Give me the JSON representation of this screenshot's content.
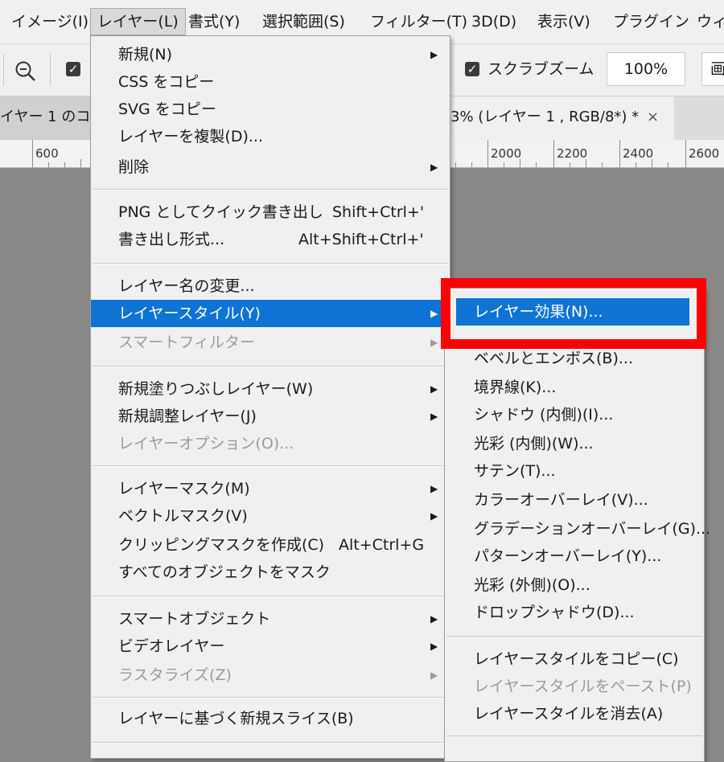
{
  "menubar": {
    "items": [
      {
        "label": "イメージ(I)"
      },
      {
        "label": "レイヤー(L)"
      },
      {
        "label": "書式(Y)"
      },
      {
        "label": "選択範囲(S)"
      },
      {
        "label": "フィルター(T)"
      },
      {
        "label": "3D(D)"
      },
      {
        "label": "表示(V)"
      },
      {
        "label": "プラグイン"
      },
      {
        "label": "ウィ"
      }
    ]
  },
  "options": {
    "scrubby_zoom_label": "スクラブズーム",
    "zoom_value": "100%",
    "fill_screen_label": "画"
  },
  "tabs": [
    {
      "label": "イヤー 1 のコ"
    },
    {
      "label": "3% (レイヤー 1 , RGB/8*) *"
    }
  ],
  "ruler": {
    "labels": [
      "600",
      "2000",
      "2200",
      "2400",
      "2600"
    ]
  },
  "layer_menu": {
    "items": [
      {
        "label": "新規(N)",
        "shortcut": "",
        "submenu": true,
        "disabled": false
      },
      {
        "label": "CSS をコピー",
        "shortcut": "",
        "submenu": false,
        "disabled": false
      },
      {
        "label": "SVG をコピー",
        "shortcut": "",
        "submenu": false,
        "disabled": false
      },
      {
        "label": "レイヤーを複製(D)...",
        "shortcut": "",
        "submenu": false,
        "disabled": false
      },
      {
        "label": "削除",
        "shortcut": "",
        "submenu": true,
        "disabled": false
      },
      {
        "label": "PNG としてクイック書き出し",
        "shortcut": "Shift+Ctrl+'",
        "submenu": false,
        "disabled": false
      },
      {
        "label": "書き出し形式...",
        "shortcut": "Alt+Shift+Ctrl+'",
        "submenu": false,
        "disabled": false
      },
      {
        "label": "レイヤー名の変更...",
        "shortcut": "",
        "submenu": false,
        "disabled": false
      },
      {
        "label": "レイヤースタイル(Y)",
        "shortcut": "",
        "submenu": true,
        "disabled": false
      },
      {
        "label": "スマートフィルター",
        "shortcut": "",
        "submenu": true,
        "disabled": true
      },
      {
        "label": "新規塗りつぶしレイヤー(W)",
        "shortcut": "",
        "submenu": true,
        "disabled": false
      },
      {
        "label": "新規調整レイヤー(J)",
        "shortcut": "",
        "submenu": true,
        "disabled": false
      },
      {
        "label": "レイヤーオプション(O)...",
        "shortcut": "",
        "submenu": false,
        "disabled": true
      },
      {
        "label": "レイヤーマスク(M)",
        "shortcut": "",
        "submenu": true,
        "disabled": false
      },
      {
        "label": "ベクトルマスク(V)",
        "shortcut": "",
        "submenu": true,
        "disabled": false
      },
      {
        "label": "クリッピングマスクを作成(C)",
        "shortcut": "Alt+Ctrl+G",
        "submenu": false,
        "disabled": false
      },
      {
        "label": "すべてのオブジェクトをマスク",
        "shortcut": "",
        "submenu": false,
        "disabled": false
      },
      {
        "label": "スマートオブジェクト",
        "shortcut": "",
        "submenu": true,
        "disabled": false
      },
      {
        "label": "ビデオレイヤー",
        "shortcut": "",
        "submenu": true,
        "disabled": false
      },
      {
        "label": "ラスタライズ(Z)",
        "shortcut": "",
        "submenu": true,
        "disabled": true
      },
      {
        "label": "レイヤーに基づく新規スライス(B)",
        "shortcut": "",
        "submenu": false,
        "disabled": false
      }
    ]
  },
  "layer_style_submenu": {
    "items": [
      {
        "label": "レイヤー効果(N)...",
        "disabled": false
      },
      {
        "label": "ベベルとエンボス(B)...",
        "disabled": false
      },
      {
        "label": "境界線(K)...",
        "disabled": false
      },
      {
        "label": "シャドウ (内側)(I)...",
        "disabled": false
      },
      {
        "label": "光彩 (内側)(W)...",
        "disabled": false
      },
      {
        "label": "サテン(T)...",
        "disabled": false
      },
      {
        "label": "カラーオーバーレイ(V)...",
        "disabled": false
      },
      {
        "label": "グラデーションオーバーレイ(G)...",
        "disabled": false
      },
      {
        "label": "パターンオーバーレイ(Y)...",
        "disabled": false
      },
      {
        "label": "光彩 (外側)(O)...",
        "disabled": false
      },
      {
        "label": "ドロップシャドウ(D)...",
        "disabled": false
      },
      {
        "label": "レイヤースタイルをコピー(C)",
        "disabled": false
      },
      {
        "label": "レイヤースタイルをペースト(P)",
        "disabled": true
      },
      {
        "label": "レイヤースタイルを消去(A)",
        "disabled": false
      }
    ]
  },
  "colors": {
    "highlight": "#0f73d3",
    "annotation": "#ff0000",
    "menu_bg": "#f0f0f0",
    "canvas_bg": "#888888"
  },
  "icons": {
    "zoom_out": "zoom-out-icon",
    "checkbox": "checkbox-checked-icon",
    "submenu_arrow": "submenu-arrow-icon",
    "tab_close": "close-icon"
  }
}
